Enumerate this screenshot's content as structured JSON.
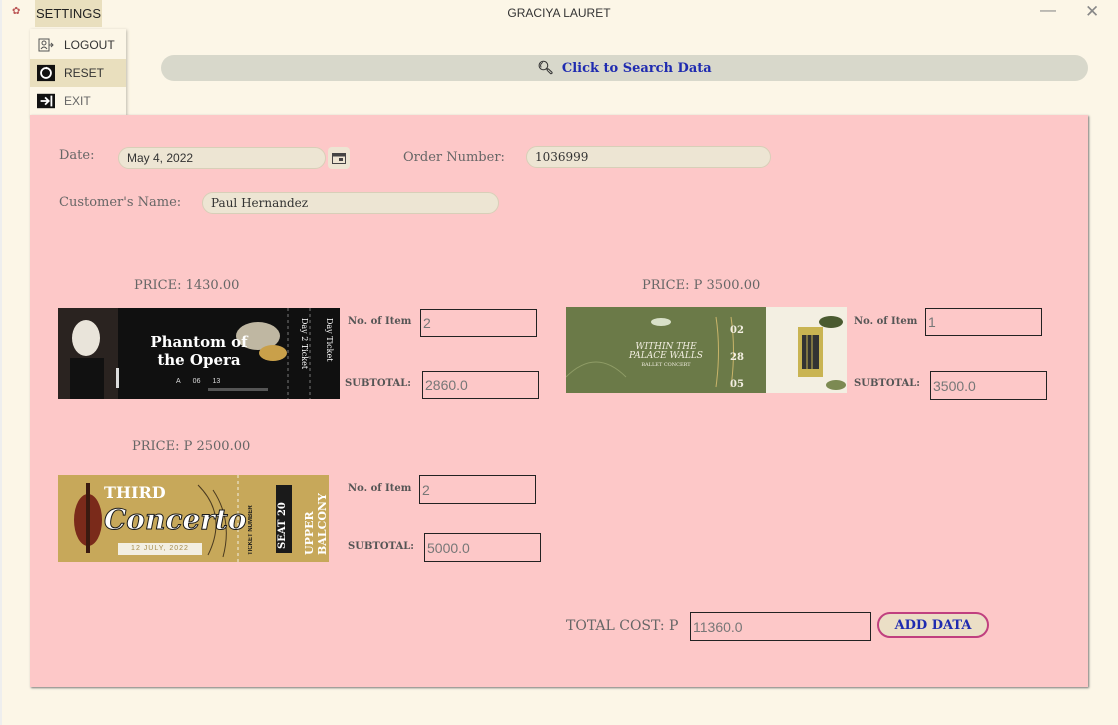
{
  "window": {
    "title": "GRACIYA LAURET",
    "menu_label": "SETTINGS",
    "minimize": "—",
    "close": "✕"
  },
  "menu": {
    "items": [
      {
        "label": "LOGOUT",
        "icon": "user-switch-icon"
      },
      {
        "label": "RESET",
        "icon": "reset-icon"
      },
      {
        "label": "EXIT",
        "icon": "exit-icon"
      }
    ]
  },
  "search": {
    "label": "Click to Search Data",
    "icon": "search-icon"
  },
  "form": {
    "date_label": "Date:",
    "date_value": "May 4, 2022",
    "order_label": "Order Number:",
    "order_value": "1036999",
    "customer_label": "Customer's Name:",
    "customer_value": "Paul Hernandez"
  },
  "items": [
    {
      "price": "PRICE: 1430.00",
      "qty_label": "No. of Item",
      "qty": "2",
      "subtotal_label": "SUBTOTAL:",
      "subtotal": "2860.0",
      "ticket": {
        "line1": "Phantom of",
        "line2": "the Opera",
        "stub1": "Day 2 Ticket",
        "stub2": "Day Ticket",
        "info": [
          "A",
          "06",
          "13"
        ]
      }
    },
    {
      "price": "PRICE: P 3500.00",
      "qty_label": "No. of Item",
      "qty": "1",
      "subtotal_label": "SUBTOTAL:",
      "subtotal": "3500.0",
      "ticket": {
        "line1": "WITHIN THE",
        "line2": "PALACE WALLS",
        "line3": "BALLET CONCERT",
        "numbers": [
          "02",
          "28",
          "05"
        ]
      }
    },
    {
      "price": "PRICE: P 2500.00",
      "qty_label": "No. of Item",
      "qty": "2",
      "subtotal_label": "SUBTOTAL:",
      "subtotal": "5000.0",
      "ticket": {
        "line1": "THIRD",
        "line2": "Concerto",
        "date": "12 JULY, 2022",
        "stub1": "TICKET NUMBER",
        "stub2": "SEAT 20",
        "stub3": "UPPER BALCONY"
      }
    }
  ],
  "total": {
    "label": "TOTAL COST: P",
    "value": "11360.0"
  },
  "actions": {
    "add_label": "ADD DATA"
  },
  "colors": {
    "panel": "#fdc8c8",
    "background": "#fcf6e7",
    "accent_text": "#1f2bb0",
    "button_border": "#c0407f"
  }
}
